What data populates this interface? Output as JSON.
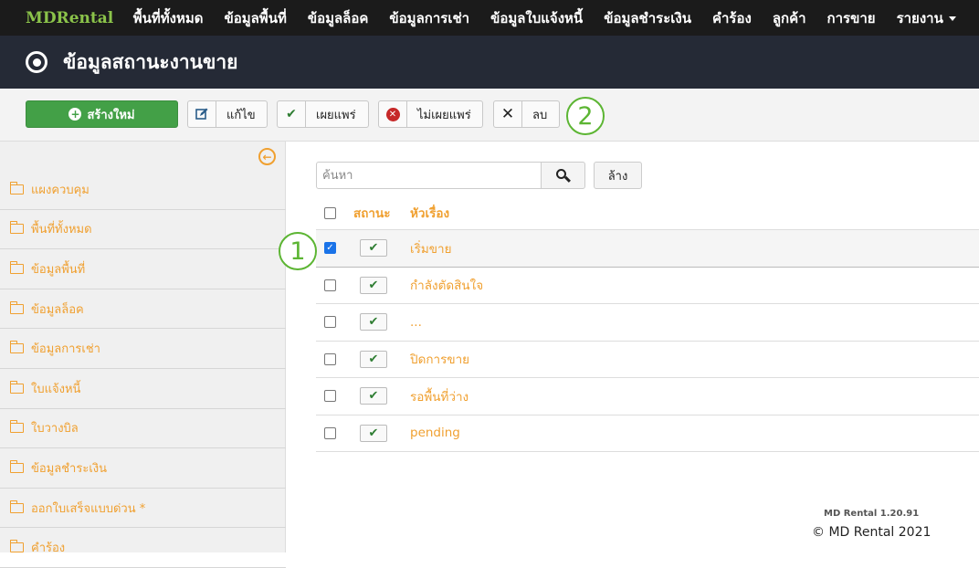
{
  "nav": {
    "brand": "MDRental",
    "items": [
      "พื้นที่ทั้งหมด",
      "ข้อมูลพื้นที่",
      "ข้อมูลล็อค",
      "ข้อมูลการเช่า",
      "ข้อมูลใบแจ้งหนี้",
      "ข้อมูลชำระเงิน",
      "คำร้อง",
      "ลูกค้า",
      "การขาย",
      "รายงาน"
    ]
  },
  "page": {
    "title": "ข้อมูลสถานะงานขาย"
  },
  "toolbar": {
    "new_label": "สร้างใหม่",
    "edit_label": "แก้ไข",
    "publish_label": "เผยแพร่",
    "unpublish_label": "ไม่เผยแพร่",
    "delete_label": "ลบ"
  },
  "callouts": {
    "one": "1",
    "two": "2"
  },
  "sidebar": {
    "items": [
      "แผงควบคุม",
      "พื้นที่ทั้งหมด",
      "ข้อมูลพื้นที่",
      "ข้อมูลล็อค",
      "ข้อมูลการเช่า",
      "ใบแจ้งหนี้",
      "ใบวางบิล",
      "ข้อมูลชำระเงิน",
      "ออกใบเสร็จแบบด่วน *",
      "คำร้อง"
    ]
  },
  "search": {
    "placeholder": "ค้นหา",
    "clear_label": "ล้าง"
  },
  "table": {
    "headers": {
      "status": "สถานะ",
      "title": "หัวเรื่อง"
    },
    "rows": [
      {
        "title": "เริ่มขาย",
        "checked": true
      },
      {
        "title": "กำลังตัดสินใจ",
        "checked": false
      },
      {
        "title": "...",
        "checked": false
      },
      {
        "title": "ปิดการขาย",
        "checked": false
      },
      {
        "title": "รอพื้นที่ว่าง",
        "checked": false
      },
      {
        "title": "pending",
        "checked": false
      }
    ]
  },
  "footer": {
    "version": "MD Rental 1.20.91",
    "copyright": "© MD Rental 2021"
  },
  "colors": {
    "accent": "#f0a030",
    "new_button": "#43a047",
    "callout": "#5cb533",
    "nav_bg": "#1b1b1b",
    "title_bg": "#252a36"
  }
}
